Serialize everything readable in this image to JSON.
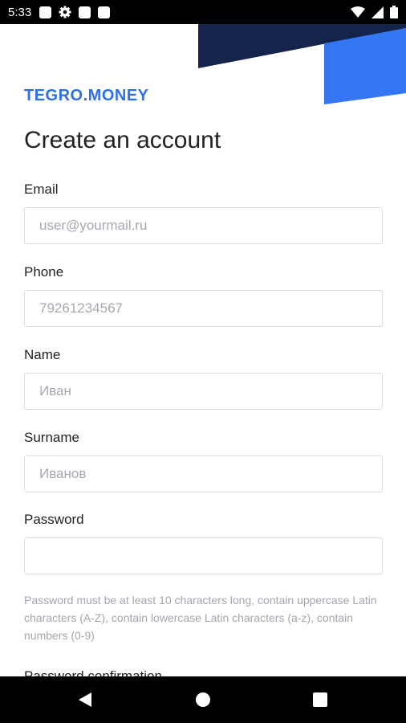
{
  "status_bar": {
    "time": "5:33",
    "left_icons": [
      "notification-square-icon",
      "gear-icon",
      "notification-square-icon",
      "notification-square-icon"
    ],
    "right_icons": [
      "wifi-icon",
      "signal-icon",
      "battery-icon"
    ]
  },
  "brand": {
    "logo_text": "TEGRO.MONEY",
    "accent_dark": "#14244a",
    "accent_blue": "#2f6fe8"
  },
  "page": {
    "title": "Create an account"
  },
  "form": {
    "email": {
      "label": "Email",
      "placeholder": "user@yourmail.ru",
      "value": ""
    },
    "phone": {
      "label": "Phone",
      "placeholder": "79261234567",
      "value": ""
    },
    "name": {
      "label": "Name",
      "placeholder": "Иван",
      "value": ""
    },
    "surname": {
      "label": "Surname",
      "placeholder": "Иванов",
      "value": ""
    },
    "password": {
      "label": "Password",
      "placeholder": "",
      "value": ""
    },
    "password_hint": "Password must be at least 10 characters long, contain uppercase Latin characters (A-Z), contain lowercase Latin characters (a-z), contain numbers (0-9)",
    "password_confirmation": {
      "label": "Password confirmation"
    }
  },
  "nav_bar": {
    "buttons": [
      "back-icon",
      "home-icon",
      "recents-icon"
    ]
  }
}
